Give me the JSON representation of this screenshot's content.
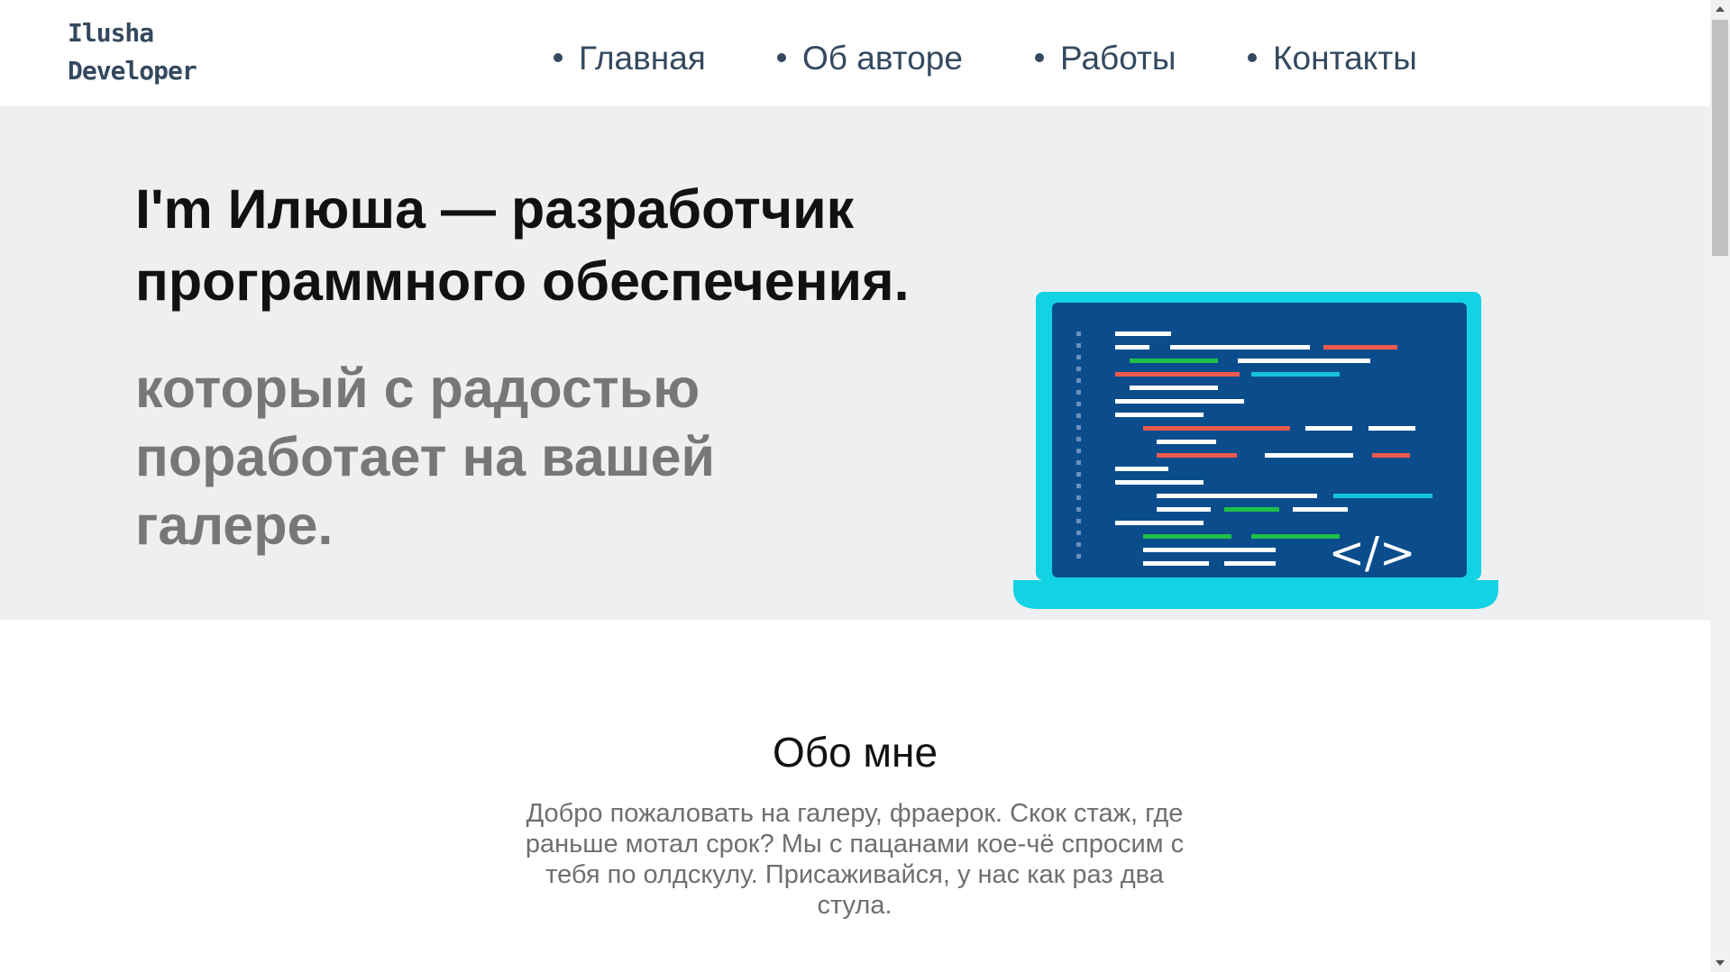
{
  "header": {
    "logo_line1": "Ilusha",
    "logo_line2": "Developer",
    "nav": [
      {
        "label": "Главная"
      },
      {
        "label": "Об авторе"
      },
      {
        "label": "Работы"
      },
      {
        "label": "Контакты"
      }
    ]
  },
  "hero": {
    "title": "I'm Илюша — разработчик программного обеспечения.",
    "subtitle": "который с радостью поработает на вашей галере.",
    "illustration": {
      "icon": "laptop-code-icon",
      "screen_glyph": "</>",
      "colors": {
        "frame": "#12d3e3",
        "screen": "#0b4d8c",
        "line_white": "#ffffff",
        "line_red": "#ef5a4e",
        "line_green": "#1fbf4a",
        "line_cyan": "#15c4df"
      }
    }
  },
  "about": {
    "title": "Обо мне",
    "text": "Добро пожаловать на галеру, фраерок. Скок стаж, где раньше мотал срок? Мы с пацанами кое-чё спросим с тебя по олдскулу. Присаживайся, у нас как раз два стула."
  },
  "colors": {
    "nav_text": "#34495e",
    "hero_bg": "#eeeff1",
    "subtitle": "#777777"
  }
}
